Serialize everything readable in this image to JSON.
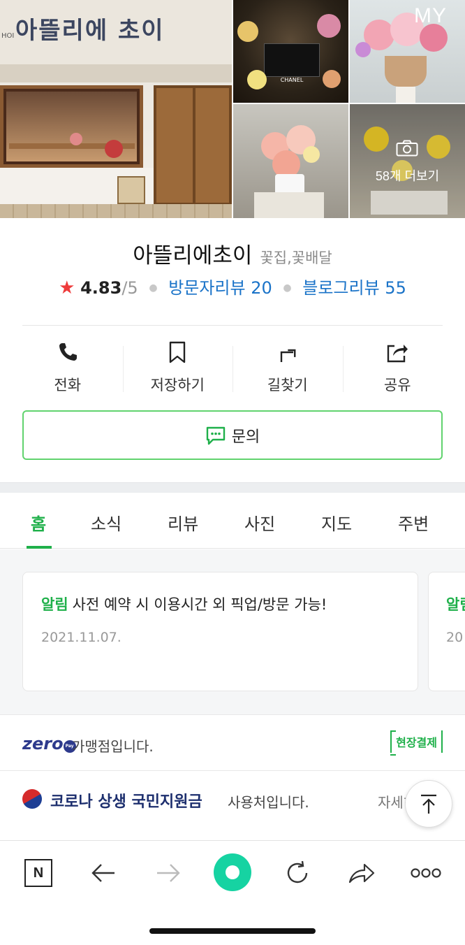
{
  "gallery": {
    "store_sign": "아뜰리에 초이",
    "sign_small": "HOI",
    "my_label": "MY",
    "photo_tr1_text": "CHANEL",
    "more_label": "58개 더보기"
  },
  "place": {
    "name": "아뜰리에초이",
    "category": "꽃집,꽃배달",
    "star": "★",
    "rating": "4.83",
    "rating_max": "/5",
    "visitor_reviews": "방문자리뷰 20",
    "blog_reviews": "블로그리뷰 55"
  },
  "actions": [
    {
      "label": "전화",
      "icon": "phone-icon"
    },
    {
      "label": "저장하기",
      "icon": "bookmark-icon"
    },
    {
      "label": "길찾기",
      "icon": "directions-icon"
    },
    {
      "label": "공유",
      "icon": "share-icon"
    }
  ],
  "inquiry": {
    "label": "문의",
    "icon": "chat-icon"
  },
  "tabs": [
    "홈",
    "소식",
    "리뷰",
    "사진",
    "지도",
    "주변"
  ],
  "notice": {
    "tag": "알림",
    "text": "사전 예약 시 이용시간 외 픽업/방문 가능!",
    "date": "2021.11.07.",
    "next_tag": "알림",
    "next_date": "20"
  },
  "zero": {
    "logo": "zero",
    "logo_pay": "Pay",
    "text": "가맹점입니다.",
    "tag": "현장결제"
  },
  "corona": {
    "title": "코로나 상생 국민지원금",
    "text": "사용처입니다.",
    "detail": "자세히"
  },
  "colors": {
    "accent_green": "#1fb04a",
    "link_blue": "#1a73c8",
    "star_red": "#ee3b3b",
    "browser_center": "#16d3a2"
  }
}
